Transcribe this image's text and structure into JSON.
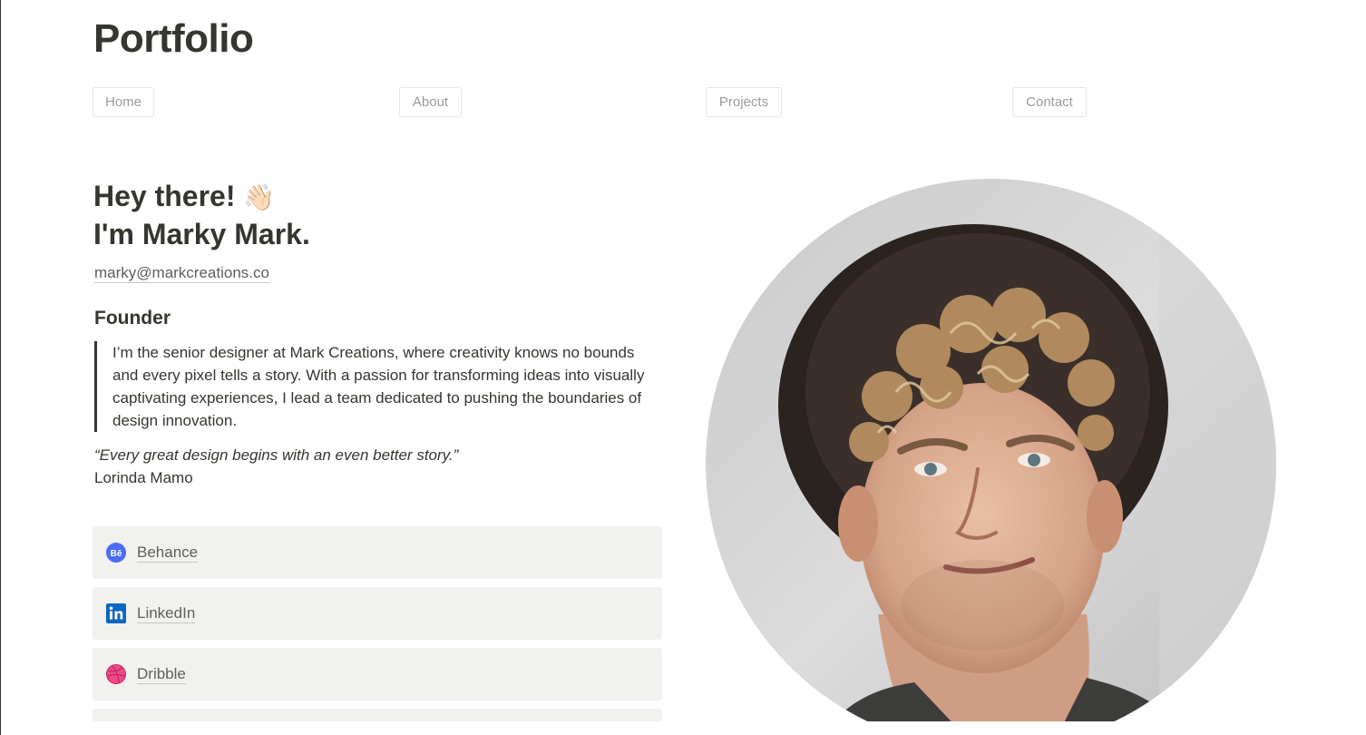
{
  "header": {
    "title": "Portfolio"
  },
  "nav": {
    "items": [
      {
        "label": "Home"
      },
      {
        "label": "About"
      },
      {
        "label": "Projects"
      },
      {
        "label": "Contact"
      }
    ]
  },
  "intro": {
    "greeting": "Hey there!",
    "greeting_emoji": "👋🏻",
    "name_line": "I'm Marky Mark.",
    "email": "marky@markcreations.co",
    "role": "Founder",
    "bio": "I’m the senior designer at Mark Creations, where creativity knows no bounds and every pixel tells a story. With a passion for transforming ideas into visually captivating experiences, I lead a team dedicated to pushing the boundaries of design innovation.",
    "quote": "“Every great design begins with an even better story.”",
    "quote_author": "Lorinda Mamo"
  },
  "links": [
    {
      "label": "Behance",
      "icon": "behance-icon",
      "color": "#4a6cf7"
    },
    {
      "label": "LinkedIn",
      "icon": "linkedin-icon",
      "color": "#0a66c2"
    },
    {
      "label": "Dribble",
      "icon": "dribbble-icon",
      "color": "#ea4c89"
    }
  ],
  "colors": {
    "text": "#37352f",
    "muted": "#9b9a97",
    "card_bg": "#f1f1ef"
  }
}
